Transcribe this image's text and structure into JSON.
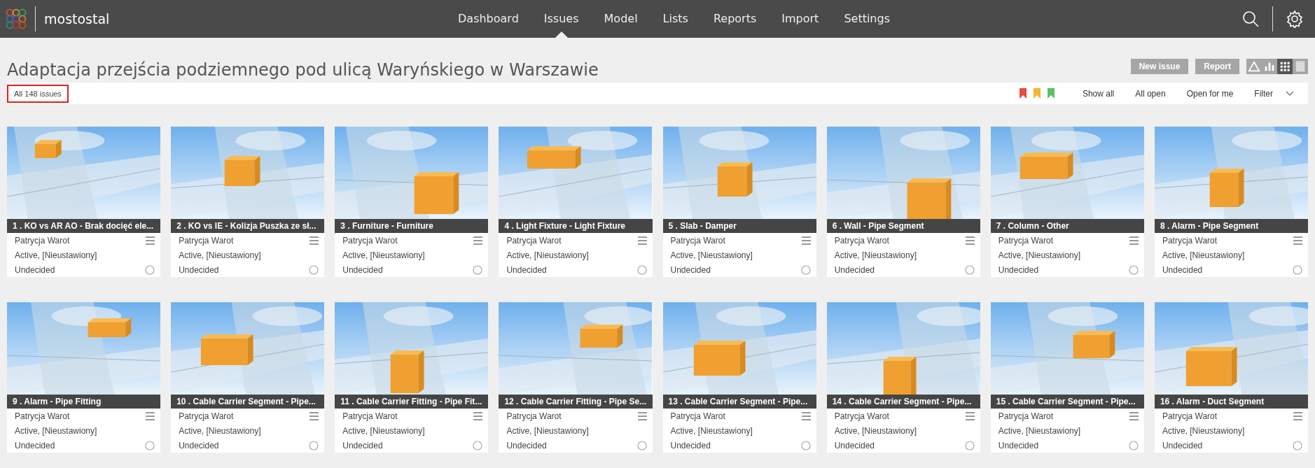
{
  "brand": {
    "name": "mostostal"
  },
  "nav": [
    {
      "label": "Dashboard",
      "selected": false
    },
    {
      "label": "Issues",
      "selected": true
    },
    {
      "label": "Model",
      "selected": false
    },
    {
      "label": "Lists",
      "selected": false
    },
    {
      "label": "Reports",
      "selected": false
    },
    {
      "label": "Import",
      "selected": false
    },
    {
      "label": "Settings",
      "selected": false
    }
  ],
  "title": "Adaptacja przejścia podziemnego pod ulicą Waryńskiego w Warszawie",
  "actions": [
    "New issue",
    "Report"
  ],
  "views": [
    {
      "kind": "triangle",
      "selected": false
    },
    {
      "kind": "bars",
      "selected": false
    },
    {
      "kind": "grid",
      "selected": true
    },
    {
      "kind": "list",
      "selected": false
    }
  ],
  "filter_bar": {
    "count": "All 148 issues",
    "count_highlighted": true,
    "flags": [
      {
        "color": "#e74c3c"
      },
      {
        "color": "#f5b731"
      },
      {
        "color": "#5cc06a"
      }
    ],
    "links": [
      "Show all",
      "All open",
      "Open for me"
    ],
    "filter": "Filter"
  },
  "issues": [
    {
      "title": "1 . KO vs AR AO - Brak docięć ele...",
      "assignee": "Patrycja Warot",
      "status": "Active, [Nieustawiony]",
      "decision": "Undecided"
    },
    {
      "title": "2 . KO vs IE - Kolizja Puszka ze sł...",
      "assignee": "Patrycja Warot",
      "status": "Active, [Nieustawiony]",
      "decision": "Undecided"
    },
    {
      "title": "3 . Furniture - Furniture",
      "assignee": "Patrycja Warot",
      "status": "Active, [Nieustawiony]",
      "decision": "Undecided"
    },
    {
      "title": "4 . Light Fixture - Light Fixture",
      "assignee": "Patrycja Warot",
      "status": "Active, [Nieustawiony]",
      "decision": "Undecided"
    },
    {
      "title": "5 . Slab - Damper",
      "assignee": "Patrycja Warot",
      "status": "Active, [Nieustawiony]",
      "decision": "Undecided"
    },
    {
      "title": "6 . Wall - Pipe Segment",
      "assignee": "Patrycja Warot",
      "status": "Active, [Nieustawiony]",
      "decision": "Undecided"
    },
    {
      "title": "7 . Column - Other",
      "assignee": "Patrycja Warot",
      "status": "Active, [Nieustawiony]",
      "decision": "Undecided"
    },
    {
      "title": "8 . Alarm - Pipe Segment",
      "assignee": "Patrycja Warot",
      "status": "Active, [Nieustawiony]",
      "decision": "Undecided"
    },
    {
      "title": "9 . Alarm - Pipe Fitting",
      "assignee": "Patrycja Warot",
      "status": "Active, [Nieustawiony]",
      "decision": "Undecided"
    },
    {
      "title": "10 . Cable Carrier Segment - Pipe...",
      "assignee": "Patrycja Warot",
      "status": "Active, [Nieustawiony]",
      "decision": "Undecided"
    },
    {
      "title": "11 . Cable Carrier Fitting - Pipe Fit...",
      "assignee": "Patrycja Warot",
      "status": "Active, [Nieustawiony]",
      "decision": "Undecided"
    },
    {
      "title": "12 . Cable Carrier Fitting - Pipe Se...",
      "assignee": "Patrycja Warot",
      "status": "Active, [Nieustawiony]",
      "decision": "Undecided"
    },
    {
      "title": "13 . Cable Carrier Segment - Pipe...",
      "assignee": "Patrycja Warot",
      "status": "Active, [Nieustawiony]",
      "decision": "Undecided"
    },
    {
      "title": "14 . Cable Carrier Segment - Pipe...",
      "assignee": "Patrycja Warot",
      "status": "Active, [Nieustawiony]",
      "decision": "Undecided"
    },
    {
      "title": "15 . Cable Carrier Segment - Pipe...",
      "assignee": "Patrycja Warot",
      "status": "Active, [Nieustawiony]",
      "decision": "Undecided"
    },
    {
      "title": "16 . Alarm - Duct Segment",
      "assignee": "Patrycja Warot",
      "status": "Active, [Nieustawiony]",
      "decision": "Undecided"
    }
  ]
}
